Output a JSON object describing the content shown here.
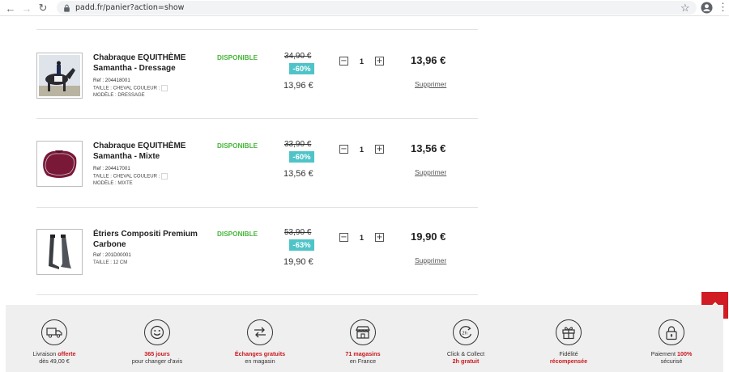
{
  "browser": {
    "url": "padd.fr/panier?action=show"
  },
  "cart": {
    "items": [
      {
        "name": "Chabraque EQUITHÈME Samantha - Dressage",
        "ref": "Ref : 204418001",
        "attr_line1": "TAILLE : CHEVAL  COULEUR :",
        "attr_line2": "MODÈLE : DRESSAGE",
        "availability": "DISPONIBLE",
        "old_price": "34,90 €",
        "discount": "-60%",
        "unit_price": "13,96 €",
        "quantity": "1",
        "total": "13,96 €",
        "remove": "Supprimer",
        "image_icon": "dressage-rider-photo"
      },
      {
        "name": "Chabraque EQUITHÈME Samantha - Mixte",
        "ref": "Ref : 204417001",
        "attr_line1": "TAILLE : CHEVAL  COULEUR :",
        "attr_line2": "MODÈLE : MIXTE",
        "availability": "DISPONIBLE",
        "old_price": "33,90 €",
        "discount": "-60%",
        "unit_price": "13,56 €",
        "quantity": "1",
        "total": "13,56 €",
        "remove": "Supprimer",
        "image_icon": "burgundy-saddle-pad"
      },
      {
        "name": "Étriers Compositi Premium Carbone",
        "ref": "Ref : 201D00001",
        "attr_line1": "TAILLE : 12 CM",
        "attr_line2": "",
        "availability": "DISPONIBLE",
        "old_price": "53,90 €",
        "discount": "-63%",
        "unit_price": "19,90 €",
        "quantity": "1",
        "total": "19,90 €",
        "remove": "Supprimer",
        "image_icon": "carbon-stirrups"
      }
    ]
  },
  "reassurance": [
    {
      "icon": "truck-icon",
      "l1_pre": "Livraison ",
      "l1_red": "offerte",
      "l1_post": "",
      "l2_pre": "dès 49,00 €",
      "l2_red": ""
    },
    {
      "icon": "smiley-icon",
      "l1_pre": "",
      "l1_red": "365 jours",
      "l1_post": "",
      "l2_pre": "pour changer d'avis",
      "l2_red": ""
    },
    {
      "icon": "exchange-icon",
      "l1_pre": "",
      "l1_red": "Échanges gratuits",
      "l1_post": "",
      "l2_pre": "en magasin",
      "l2_red": ""
    },
    {
      "icon": "store-icon",
      "l1_pre": "",
      "l1_red": "71 magasins",
      "l1_post": "",
      "l2_pre": "en France",
      "l2_red": ""
    },
    {
      "icon": "click-collect-icon",
      "l1_pre": "Click & Collect",
      "l1_red": "",
      "l1_post": "",
      "l2_pre": "",
      "l2_red": "2h gratuit"
    },
    {
      "icon": "gift-icon",
      "l1_pre": "Fidélité",
      "l1_red": "",
      "l1_post": "",
      "l2_pre": "",
      "l2_red": "récompensée"
    },
    {
      "icon": "padlock-icon",
      "l1_pre": "Paiement ",
      "l1_red": "100%",
      "l1_post": "",
      "l2_pre": "sécurisé",
      "l2_red": ""
    }
  ],
  "colors": {
    "accent_red": "#d01c22",
    "discount_teal": "#4fc4c8",
    "available_green": "#47b73b"
  }
}
